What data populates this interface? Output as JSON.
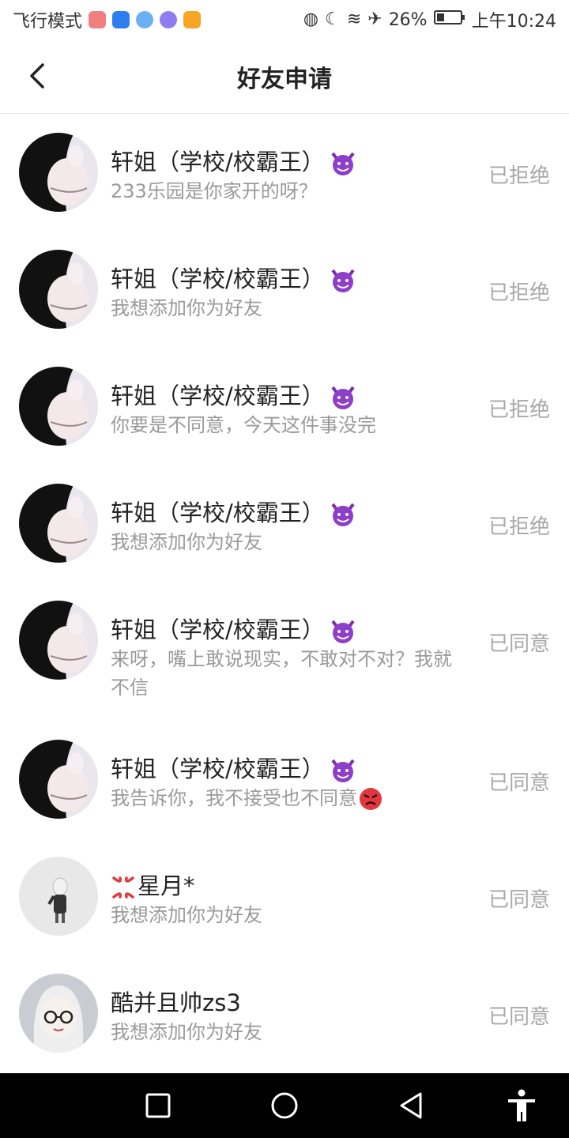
{
  "status_bar": {
    "left_text": "飞行模式",
    "battery": "26%",
    "time": "上午10:24"
  },
  "header": {
    "title": "好友申请"
  },
  "requests": [
    {
      "name": "轩姐（学校/校霸王）",
      "message": "233乐园是你家开的呀？",
      "status": "已拒绝"
    },
    {
      "name": "轩姐（学校/校霸王）",
      "message": "我想添加你为好友",
      "status": "已拒绝"
    },
    {
      "name": "轩姐（学校/校霸王）",
      "message": "你要是不同意，今天这件事没完",
      "status": "已拒绝"
    },
    {
      "name": "轩姐（学校/校霸王）",
      "message": "我想添加你为好友",
      "status": "已拒绝"
    },
    {
      "name": "轩姐（学校/校霸王）",
      "message": "来呀，嘴上敢说现实，不敢对不对？我就不信",
      "status": "已同意"
    },
    {
      "name": "轩姐（学校/校霸王）",
      "message": "我告诉你，我不接受也不同意",
      "status": "已同意"
    },
    {
      "name": "星月*",
      "message": "我想添加你为好友",
      "status": "已同意"
    },
    {
      "name": "酷并且帅zs3",
      "message": "我想添加你为好友",
      "status": "已同意"
    }
  ],
  "icons": {
    "back": "chevron-left-icon",
    "nav_recent": "square-icon",
    "nav_home": "circle-icon",
    "nav_back": "triangle-icon",
    "nav_accessibility": "accessibility-icon"
  }
}
